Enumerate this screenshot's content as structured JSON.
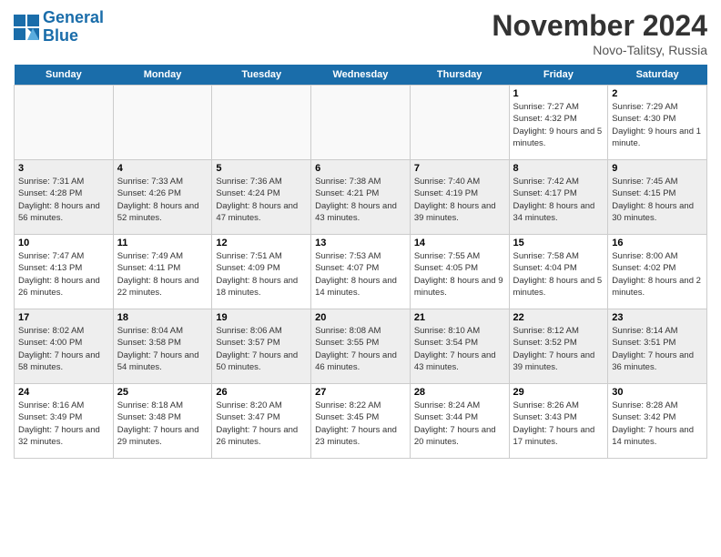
{
  "header": {
    "logo_line1": "General",
    "logo_line2": "Blue",
    "month": "November 2024",
    "location": "Novo-Talitsy, Russia"
  },
  "days_of_week": [
    "Sunday",
    "Monday",
    "Tuesday",
    "Wednesday",
    "Thursday",
    "Friday",
    "Saturday"
  ],
  "weeks": [
    [
      {
        "day": "",
        "info": ""
      },
      {
        "day": "",
        "info": ""
      },
      {
        "day": "",
        "info": ""
      },
      {
        "day": "",
        "info": ""
      },
      {
        "day": "",
        "info": ""
      },
      {
        "day": "1",
        "info": "Sunrise: 7:27 AM\nSunset: 4:32 PM\nDaylight: 9 hours and 5 minutes."
      },
      {
        "day": "2",
        "info": "Sunrise: 7:29 AM\nSunset: 4:30 PM\nDaylight: 9 hours and 1 minute."
      }
    ],
    [
      {
        "day": "3",
        "info": "Sunrise: 7:31 AM\nSunset: 4:28 PM\nDaylight: 8 hours and 56 minutes."
      },
      {
        "day": "4",
        "info": "Sunrise: 7:33 AM\nSunset: 4:26 PM\nDaylight: 8 hours and 52 minutes."
      },
      {
        "day": "5",
        "info": "Sunrise: 7:36 AM\nSunset: 4:24 PM\nDaylight: 8 hours and 47 minutes."
      },
      {
        "day": "6",
        "info": "Sunrise: 7:38 AM\nSunset: 4:21 PM\nDaylight: 8 hours and 43 minutes."
      },
      {
        "day": "7",
        "info": "Sunrise: 7:40 AM\nSunset: 4:19 PM\nDaylight: 8 hours and 39 minutes."
      },
      {
        "day": "8",
        "info": "Sunrise: 7:42 AM\nSunset: 4:17 PM\nDaylight: 8 hours and 34 minutes."
      },
      {
        "day": "9",
        "info": "Sunrise: 7:45 AM\nSunset: 4:15 PM\nDaylight: 8 hours and 30 minutes."
      }
    ],
    [
      {
        "day": "10",
        "info": "Sunrise: 7:47 AM\nSunset: 4:13 PM\nDaylight: 8 hours and 26 minutes."
      },
      {
        "day": "11",
        "info": "Sunrise: 7:49 AM\nSunset: 4:11 PM\nDaylight: 8 hours and 22 minutes."
      },
      {
        "day": "12",
        "info": "Sunrise: 7:51 AM\nSunset: 4:09 PM\nDaylight: 8 hours and 18 minutes."
      },
      {
        "day": "13",
        "info": "Sunrise: 7:53 AM\nSunset: 4:07 PM\nDaylight: 8 hours and 14 minutes."
      },
      {
        "day": "14",
        "info": "Sunrise: 7:55 AM\nSunset: 4:05 PM\nDaylight: 8 hours and 9 minutes."
      },
      {
        "day": "15",
        "info": "Sunrise: 7:58 AM\nSunset: 4:04 PM\nDaylight: 8 hours and 5 minutes."
      },
      {
        "day": "16",
        "info": "Sunrise: 8:00 AM\nSunset: 4:02 PM\nDaylight: 8 hours and 2 minutes."
      }
    ],
    [
      {
        "day": "17",
        "info": "Sunrise: 8:02 AM\nSunset: 4:00 PM\nDaylight: 7 hours and 58 minutes."
      },
      {
        "day": "18",
        "info": "Sunrise: 8:04 AM\nSunset: 3:58 PM\nDaylight: 7 hours and 54 minutes."
      },
      {
        "day": "19",
        "info": "Sunrise: 8:06 AM\nSunset: 3:57 PM\nDaylight: 7 hours and 50 minutes."
      },
      {
        "day": "20",
        "info": "Sunrise: 8:08 AM\nSunset: 3:55 PM\nDaylight: 7 hours and 46 minutes."
      },
      {
        "day": "21",
        "info": "Sunrise: 8:10 AM\nSunset: 3:54 PM\nDaylight: 7 hours and 43 minutes."
      },
      {
        "day": "22",
        "info": "Sunrise: 8:12 AM\nSunset: 3:52 PM\nDaylight: 7 hours and 39 minutes."
      },
      {
        "day": "23",
        "info": "Sunrise: 8:14 AM\nSunset: 3:51 PM\nDaylight: 7 hours and 36 minutes."
      }
    ],
    [
      {
        "day": "24",
        "info": "Sunrise: 8:16 AM\nSunset: 3:49 PM\nDaylight: 7 hours and 32 minutes."
      },
      {
        "day": "25",
        "info": "Sunrise: 8:18 AM\nSunset: 3:48 PM\nDaylight: 7 hours and 29 minutes."
      },
      {
        "day": "26",
        "info": "Sunrise: 8:20 AM\nSunset: 3:47 PM\nDaylight: 7 hours and 26 minutes."
      },
      {
        "day": "27",
        "info": "Sunrise: 8:22 AM\nSunset: 3:45 PM\nDaylight: 7 hours and 23 minutes."
      },
      {
        "day": "28",
        "info": "Sunrise: 8:24 AM\nSunset: 3:44 PM\nDaylight: 7 hours and 20 minutes."
      },
      {
        "day": "29",
        "info": "Sunrise: 8:26 AM\nSunset: 3:43 PM\nDaylight: 7 hours and 17 minutes."
      },
      {
        "day": "30",
        "info": "Sunrise: 8:28 AM\nSunset: 3:42 PM\nDaylight: 7 hours and 14 minutes."
      }
    ]
  ]
}
